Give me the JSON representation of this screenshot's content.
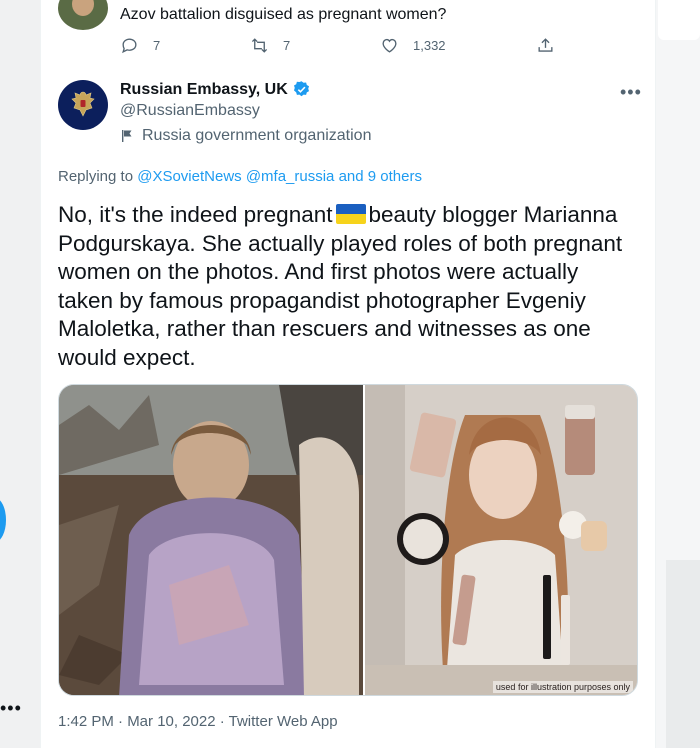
{
  "previous_tweet": {
    "text": "Azov battalion disguised as pregnant women?",
    "reply_count": "7",
    "retweet_count": "7",
    "like_count": "1,332"
  },
  "tweet": {
    "display_name": "Russian Embassy, UK",
    "handle": "@RussianEmbassy",
    "label": "Russia government organization",
    "replying_prefix": "Replying to",
    "replying_targets": "@XSovietNews @mfa_russia and 9 others",
    "text_part1": "No, it's the indeed pregnant",
    "text_part2": "beauty blogger Marianna Podgurskaya. She actually played roles of both pregnant women on the photos. And first photos were actually taken by famous propagandist photographer Evgeniy Maloletka, rather than rescuers and witnesses as one would expect.",
    "image_caption": "used for illustration purposes only",
    "timestamp": "1:42 PM · Mar 10, 2022 · Twitter Web App"
  },
  "icons": {
    "reply": "reply-icon",
    "retweet": "retweet-icon",
    "like": "heart-icon",
    "share": "share-icon",
    "verified": "verified-badge-icon",
    "government": "flag-label-icon",
    "more": "more-options-icon",
    "ukraine_flag": "ukraine-flag-emoji"
  },
  "colors": {
    "link": "#1d9bf0",
    "secondary_text": "#536471",
    "primary_text": "#0f1419",
    "verified": "#1d9bf0"
  }
}
